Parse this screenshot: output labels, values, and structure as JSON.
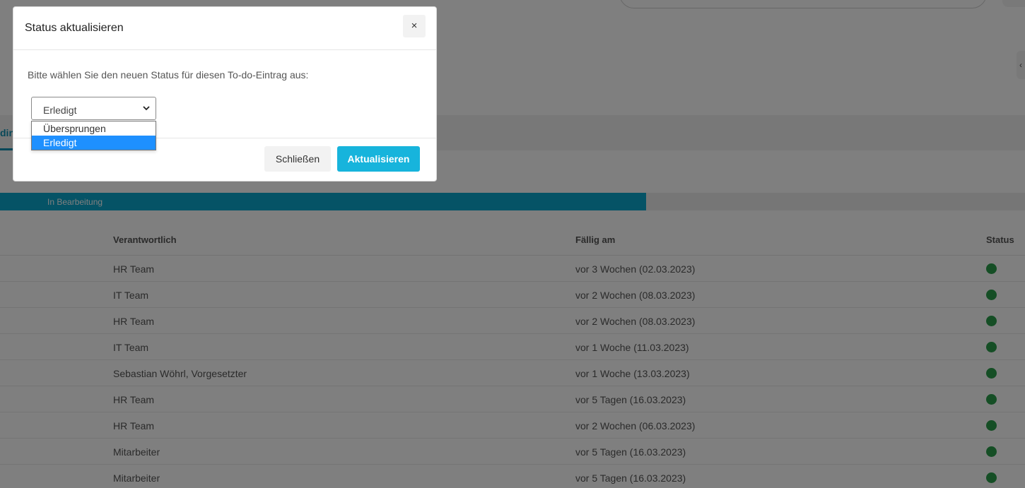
{
  "background": {
    "tab_fragment": "din",
    "progress": {
      "label": "In Bearbeitung",
      "fraction": 0.63
    },
    "table": {
      "headers": [
        "Verantwortlich",
        "Fällig am",
        "Status"
      ],
      "rows": [
        {
          "owner": "HR Team",
          "due": "vor 3 Wochen (02.03.2023)",
          "status": "green"
        },
        {
          "owner": "IT Team",
          "due": "vor 2 Wochen (08.03.2023)",
          "status": "green"
        },
        {
          "owner": "HR Team",
          "due": "vor 2 Wochen (08.03.2023)",
          "status": "green"
        },
        {
          "owner": "IT Team",
          "due": "vor 1 Woche (11.03.2023)",
          "status": "green"
        },
        {
          "owner": "Sebastian Wöhrl, Vorgesetzter",
          "due": "vor 1 Woche (13.03.2023)",
          "status": "green"
        },
        {
          "owner": "HR Team",
          "due": "vor 5 Tagen (16.03.2023)",
          "status": "green"
        },
        {
          "owner": "HR Team",
          "due": "vor 2 Wochen (06.03.2023)",
          "status": "green"
        },
        {
          "owner": "Mitarbeiter",
          "due": "vor 5 Tagen (16.03.2023)",
          "status": "green"
        },
        {
          "owner": "Mitarbeiter",
          "due": "vor 5 Tagen (16.03.2023)",
          "status": "green"
        }
      ]
    }
  },
  "modal": {
    "title": "Status aktualisieren",
    "close_symbol": "×",
    "prompt": "Bitte wählen Sie den neuen Status für diesen To-do-Eintrag aus:",
    "select": {
      "value": "Erledigt",
      "options": [
        "Übersprungen",
        "Erledigt"
      ],
      "highlighted": "Erledigt"
    },
    "buttons": {
      "close": "Schließen",
      "update": "Aktualisieren"
    }
  },
  "colors": {
    "accent": "#17b4dc",
    "progress": "#0aa6cc",
    "status_green": "#2a9d4b",
    "highlight": "#1e90ff"
  }
}
